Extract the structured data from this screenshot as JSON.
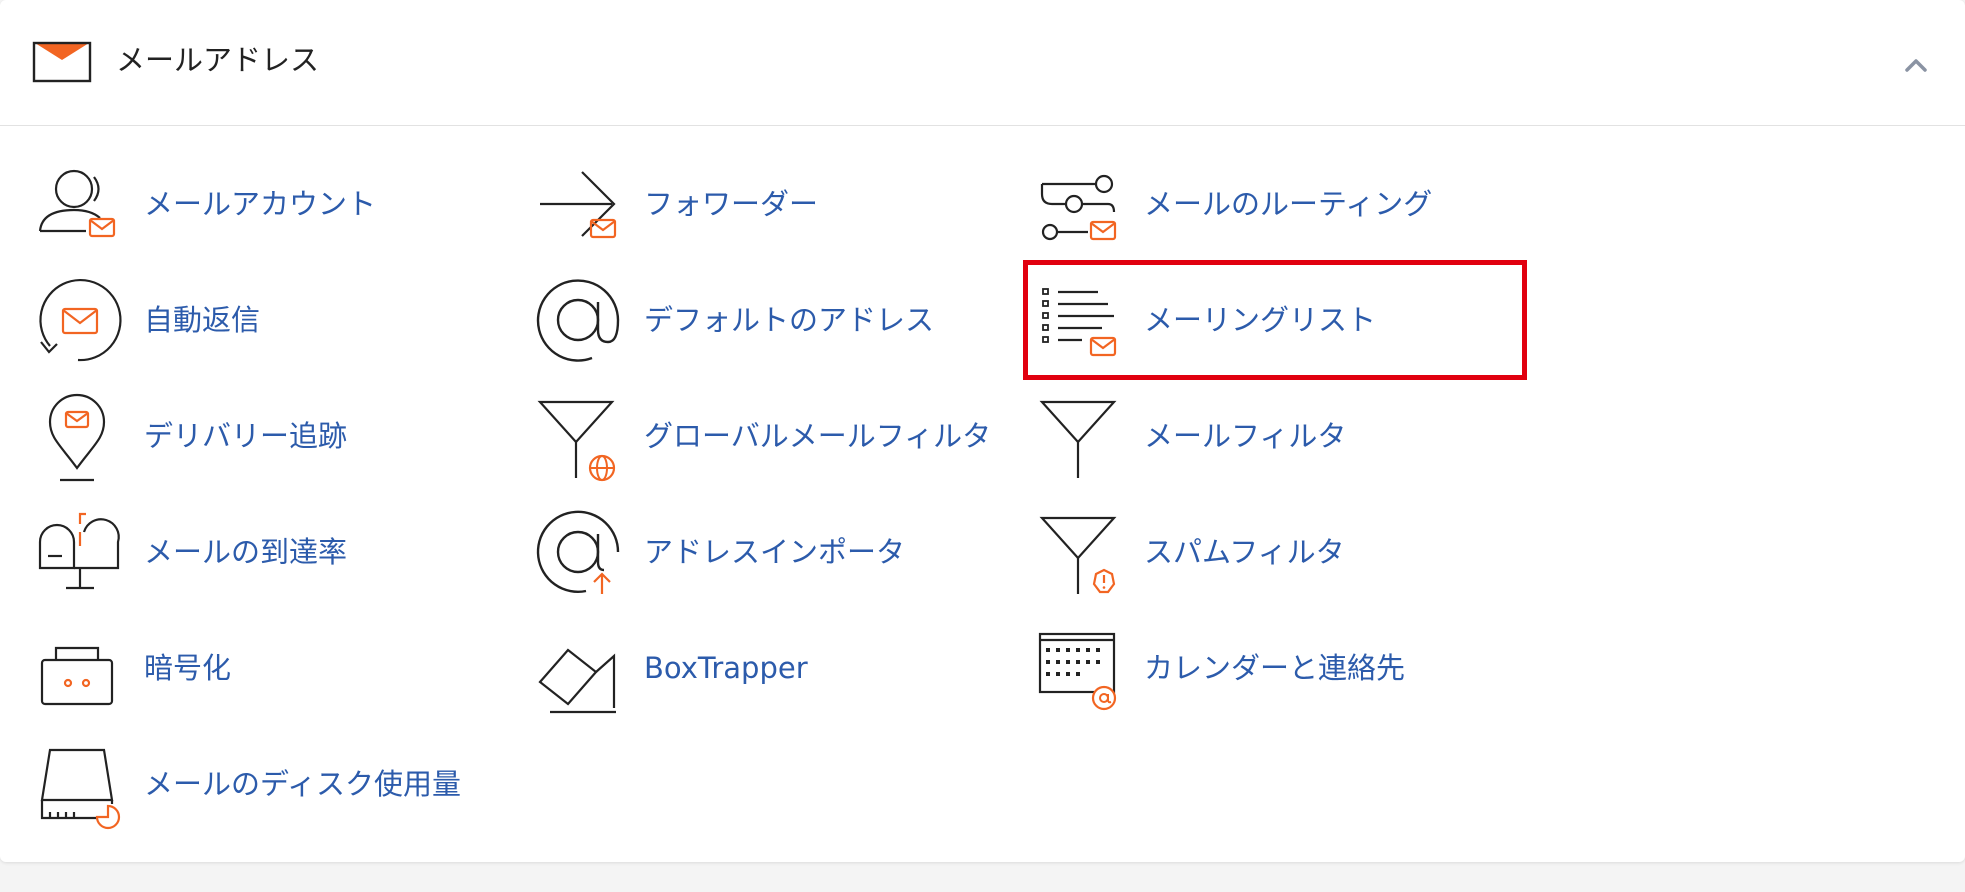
{
  "section": {
    "title": "メールアドレス",
    "icon": "envelope-icon",
    "toggle_icon": "chevron-up-icon"
  },
  "colors": {
    "accent": "#f26522",
    "link": "#2c5bab",
    "highlight": "#e1000f"
  },
  "items": [
    {
      "label": "メールアカウント",
      "icon": "user-mail-icon"
    },
    {
      "label": "自動返信",
      "icon": "autoresponder-icon"
    },
    {
      "label": "デリバリー追跡",
      "icon": "location-pin-mail-icon"
    },
    {
      "label": "メールの到達率",
      "icon": "mailbox-icon"
    },
    {
      "label": "暗号化",
      "icon": "lock-box-icon"
    },
    {
      "label": "メールのディスク使用量",
      "icon": "disk-usage-icon"
    },
    {
      "label": "フォワーダー",
      "icon": "forward-arrow-mail-icon"
    },
    {
      "label": "デフォルトのアドレス",
      "icon": "at-sign-icon"
    },
    {
      "label": "グローバルメールフィルタ",
      "icon": "funnel-globe-icon"
    },
    {
      "label": "アドレスインポータ",
      "icon": "at-sign-import-icon"
    },
    {
      "label": "BoxTrapper",
      "icon": "eraser-icon"
    },
    {
      "label": "メールのルーティング",
      "icon": "routing-sliders-icon"
    },
    {
      "label": "メーリングリスト",
      "icon": "list-mail-icon"
    },
    {
      "label": "メールフィルタ",
      "icon": "funnel-icon"
    },
    {
      "label": "スパムフィルタ",
      "icon": "funnel-alert-icon"
    },
    {
      "label": "カレンダーと連絡先",
      "icon": "calendar-at-icon"
    }
  ]
}
